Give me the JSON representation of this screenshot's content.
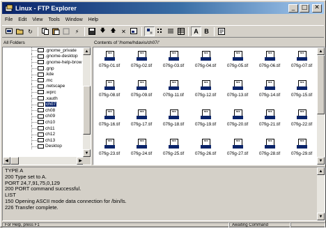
{
  "window": {
    "title": "Linux - FTP Explorer",
    "controls": {
      "minimize": "_",
      "maximize": "□",
      "close": "✕"
    }
  },
  "menu": [
    "File",
    "Edit",
    "View",
    "Tools",
    "Window",
    "Help"
  ],
  "toolbar": {
    "bold_a": "A",
    "bold_b": "B",
    "icons": [
      "connect-icon",
      "open-folder-icon",
      "refresh-icon",
      "copy-icon",
      "paste-icon",
      "paste-alt-icon",
      "disconnect-icon",
      "save-icon",
      "download-icon",
      "up-arrow-icon",
      "delete-icon",
      "properties-icon",
      "large-icons-view-icon",
      "small-icons-view-icon",
      "list-view-icon",
      "details-view-icon",
      "text-mode-icon"
    ]
  },
  "left_pane": {
    "header": "All Folders",
    "items": [
      {
        "label": ".gnome_private"
      },
      {
        "label": ".gnome-desktop"
      },
      {
        "label": ".gnome-help-brow"
      },
      {
        "label": ".gnp"
      },
      {
        "label": ".kde"
      },
      {
        "label": ".mc"
      },
      {
        "label": ".netscape"
      },
      {
        "label": ".wprc"
      },
      {
        "label": ".xauth"
      },
      {
        "label": "ch07"
      },
      {
        "label": "ch08"
      },
      {
        "label": "ch09"
      },
      {
        "label": "ch10"
      },
      {
        "label": "ch11"
      },
      {
        "label": "ch12"
      },
      {
        "label": "ch13"
      },
      {
        "label": "Desktop"
      }
    ],
    "selected": "ch07"
  },
  "right_pane": {
    "header": "Contents of '/home/hdavis/ch07/'",
    "icon_badge": "TIFF",
    "files": [
      "07fig-01.tif",
      "07fig-02.tif",
      "07fig-03.tif",
      "07fig-04.tif",
      "07fig-05.tif",
      "07fig-06.tif",
      "07fig-07.tif",
      "07fig-08.tif",
      "07fig-09.tif",
      "07fig-11.tif",
      "07fig-12.tif",
      "07fig-13.tif",
      "07fig-14.tif",
      "07fig-15.tif",
      "07fig-16.tif",
      "07fig-17.tif",
      "07fig-18.tif",
      "07fig-19.tif",
      "07fig-20.tif",
      "07fig-21.tif",
      "07fig-22.tif",
      "07fig-23.tif",
      "07fig-24.tif",
      "07fig-25.tif",
      "07fig-26.tif",
      "07fig-27.tif",
      "07fig-28.tif",
      "07fig-29.tif"
    ]
  },
  "log": [
    "TYPE A",
    "200 Type set to A.",
    "PORT 24,7,91,75,0,129",
    "200 PORT command successful.",
    "LIST",
    "150 Opening ASCII mode data connection for /bin/ls.",
    "226 Transfer complete."
  ],
  "status": {
    "help": "For Help, press F1",
    "state": "Awaiting Command"
  },
  "colors": {
    "title_start": "#0a246a",
    "title_end": "#a6caf0",
    "selection": "#0a246a",
    "face": "#d4d0c8"
  }
}
